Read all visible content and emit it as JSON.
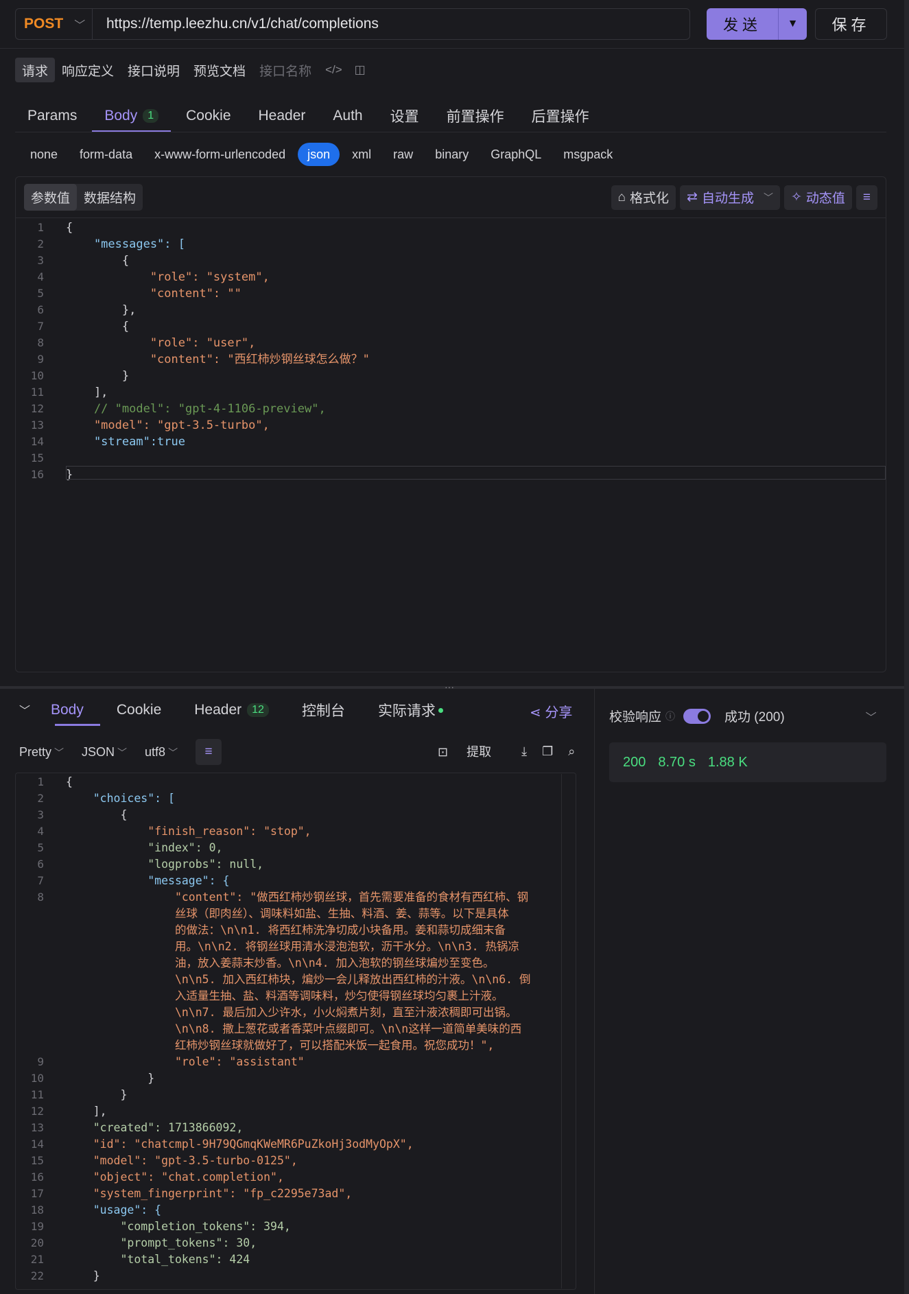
{
  "request": {
    "method": "POST",
    "url": "https://temp.leezhu.cn/v1/chat/completions",
    "send_label": "发送",
    "save_label": "保存"
  },
  "subtabs": [
    "请求",
    "响应定义",
    "接口说明",
    "预览文档"
  ],
  "api_name_placeholder": "接口名称",
  "tabs": [
    {
      "label": "Params"
    },
    {
      "label": "Body",
      "badge": "1"
    },
    {
      "label": "Cookie"
    },
    {
      "label": "Header"
    },
    {
      "label": "Auth"
    },
    {
      "label": "设置"
    },
    {
      "label": "前置操作"
    },
    {
      "label": "后置操作"
    }
  ],
  "body_types": [
    "none",
    "form-data",
    "x-www-form-urlencoded",
    "json",
    "xml",
    "raw",
    "binary",
    "GraphQL",
    "msgpack"
  ],
  "editor_toolbar": {
    "seg_values": "参数值",
    "seg_schema": "数据结构",
    "format": "格式化",
    "auto_gen": "自动生成",
    "dynamic": "动态值"
  },
  "request_body_lines": [
    "{",
    "    \"messages\": [",
    "        {",
    "            \"role\": \"system\",",
    "            \"content\": \"\"",
    "        },",
    "        {",
    "            \"role\": \"user\",",
    "            \"content\": \"西红柿炒钢丝球怎么做？\"",
    "        }",
    "    ],",
    "    // \"model\": \"gpt-4-1106-preview\",",
    "    \"model\": \"gpt-3.5-turbo\",",
    "    \"stream\":true",
    "",
    "}"
  ],
  "response_tabs": [
    {
      "label": "Body"
    },
    {
      "label": "Cookie"
    },
    {
      "label": "Header",
      "badge": "12"
    },
    {
      "label": "控制台"
    },
    {
      "label": "实际请求"
    }
  ],
  "share_label": "分享",
  "response_toolbar": {
    "pretty": "Pretty",
    "format": "JSON",
    "encoding": "utf8",
    "extract": "提取"
  },
  "response_lines": [
    {
      "n": "1",
      "t": "{"
    },
    {
      "n": "2",
      "t": "    \"choices\": ["
    },
    {
      "n": "3",
      "t": "        {"
    },
    {
      "n": "4",
      "t": "            \"finish_reason\": \"stop\","
    },
    {
      "n": "5",
      "t": "            \"index\": 0,"
    },
    {
      "n": "6",
      "t": "            \"logprobs\": null,"
    },
    {
      "n": "7",
      "t": "            \"message\": {"
    },
    {
      "n": "8",
      "t": "                \"content\": \"做西红柿炒钢丝球，首先需要准备的食材有西红柿、钢"
    },
    {
      "n": "",
      "t": "                丝球（即肉丝）、调味料如盐、生抽、料酒、姜、蒜等。以下是具体"
    },
    {
      "n": "",
      "t": "                的做法：\\n\\n1. 将西红柿洗净切成小块备用。姜和蒜切成细末备"
    },
    {
      "n": "",
      "t": "                用。\\n\\n2. 将钢丝球用清水浸泡泡软，沥干水分。\\n\\n3. 热锅凉"
    },
    {
      "n": "",
      "t": "                油，放入姜蒜末炒香。\\n\\n4. 加入泡软的钢丝球煸炒至变色。"
    },
    {
      "n": "",
      "t": "                \\n\\n5. 加入西红柿块，煸炒一会儿释放出西红柿的汁液。\\n\\n6. 倒"
    },
    {
      "n": "",
      "t": "                入适量生抽、盐、料酒等调味料，炒匀使得钢丝球均匀裹上汁液。"
    },
    {
      "n": "",
      "t": "                \\n\\n7. 最后加入少许水，小火焖煮片刻，直至汁液浓稠即可出锅。"
    },
    {
      "n": "",
      "t": "                \\n\\n8. 撒上葱花或者香菜叶点缀即可。\\n\\n这样一道简单美味的西"
    },
    {
      "n": "",
      "t": "                红柿炒钢丝球就做好了，可以搭配米饭一起食用。祝您成功！\","
    },
    {
      "n": "9",
      "t": "                \"role\": \"assistant\""
    },
    {
      "n": "10",
      "t": "            }"
    },
    {
      "n": "11",
      "t": "        }"
    },
    {
      "n": "12",
      "t": "    ],"
    },
    {
      "n": "13",
      "t": "    \"created\": 1713866092,"
    },
    {
      "n": "14",
      "t": "    \"id\": \"chatcmpl-9H79QGmqKWeMR6PuZkoHj3odMyOpX\","
    },
    {
      "n": "15",
      "t": "    \"model\": \"gpt-3.5-turbo-0125\","
    },
    {
      "n": "16",
      "t": "    \"object\": \"chat.completion\","
    },
    {
      "n": "17",
      "t": "    \"system_fingerprint\": \"fp_c2295e73ad\","
    },
    {
      "n": "18",
      "t": "    \"usage\": {"
    },
    {
      "n": "19",
      "t": "        \"completion_tokens\": 394,"
    },
    {
      "n": "20",
      "t": "        \"prompt_tokens\": 30,"
    },
    {
      "n": "21",
      "t": "        \"total_tokens\": 424"
    },
    {
      "n": "22",
      "t": "    }"
    }
  ],
  "verify": {
    "label": "校验响应",
    "result": "成功 (200)"
  },
  "status": {
    "code": "200",
    "time": "8.70 s",
    "size": "1.88 K"
  },
  "colors": {
    "accent": "#8b7be0",
    "method": "#f08a24",
    "success": "#4ade80",
    "json_active": "#1f6feb"
  }
}
